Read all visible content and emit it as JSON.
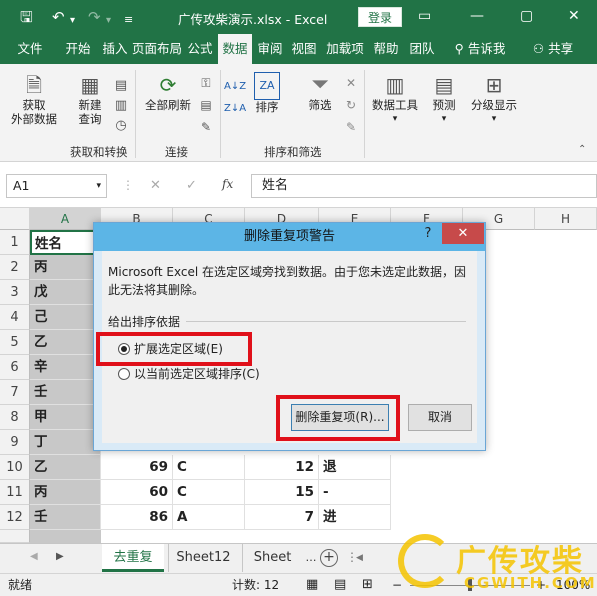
{
  "titlebar": {
    "window_title": "广传攻柴演示.xlsx  -  Excel",
    "login": "登录",
    "save_icon": "save-icon",
    "undo_icon": "undo-icon",
    "redo_icon": "redo-icon"
  },
  "tabs": [
    "文件",
    "开始",
    "插入",
    "页面布局",
    "公式",
    "数据",
    "审阅",
    "视图",
    "加载项",
    "帮助",
    "团队",
    "告诉我",
    "共享"
  ],
  "ribbon": {
    "get_data": "获取\n外部数据",
    "new_query": "新建\n查询",
    "refresh_all": "全部刷新",
    "sort": "排序",
    "filter": "筛选",
    "data_tools": "数据工具",
    "forecast": "预测",
    "outline": "分级显示",
    "groups": [
      "获取和转换",
      "连接",
      "排序和筛选"
    ]
  },
  "formula_bar": {
    "name_box": "A1",
    "cancel": "✕",
    "enter": "✓",
    "fx": "fx",
    "value": "姓名"
  },
  "grid": {
    "columns": [
      "A",
      "B",
      "C",
      "D",
      "E",
      "F",
      "G",
      "H"
    ],
    "rows": [
      "1",
      "2",
      "3",
      "4",
      "5",
      "6",
      "7",
      "8",
      "9",
      "10",
      "11",
      "12"
    ],
    "col_a": [
      "姓名",
      "丙",
      "戊",
      "己",
      "乙",
      "辛",
      "壬",
      "甲",
      "丁",
      "乙",
      "丙",
      "壬"
    ],
    "visible_rows": [
      {
        "b": "69",
        "c": "C",
        "d": "12",
        "e": "退"
      },
      {
        "b": "60",
        "c": "C",
        "d": "15",
        "e": "-"
      },
      {
        "b": "86",
        "c": "A",
        "d": "7",
        "e": "进"
      }
    ]
  },
  "sheets": {
    "tabs": [
      "去重复",
      "Sheet12",
      "Sheet"
    ],
    "add": "+"
  },
  "status": {
    "ready": "就绪",
    "count": "计数: 12",
    "zoom": "100%"
  },
  "dialog": {
    "title": "删除重复项警告",
    "help": "?",
    "message": "Microsoft Excel 在选定区域旁找到数据。由于您未选定此数据，因此无法将其删除。",
    "group_label": "给出排序依据",
    "option1": "扩展选定区域(E)",
    "option2": "以当前选定区域排序(C)",
    "ok": "删除重复项(R)...",
    "cancel": "取消"
  },
  "watermark": {
    "text": "广传攻柴",
    "url": "CGWITH.COM"
  }
}
